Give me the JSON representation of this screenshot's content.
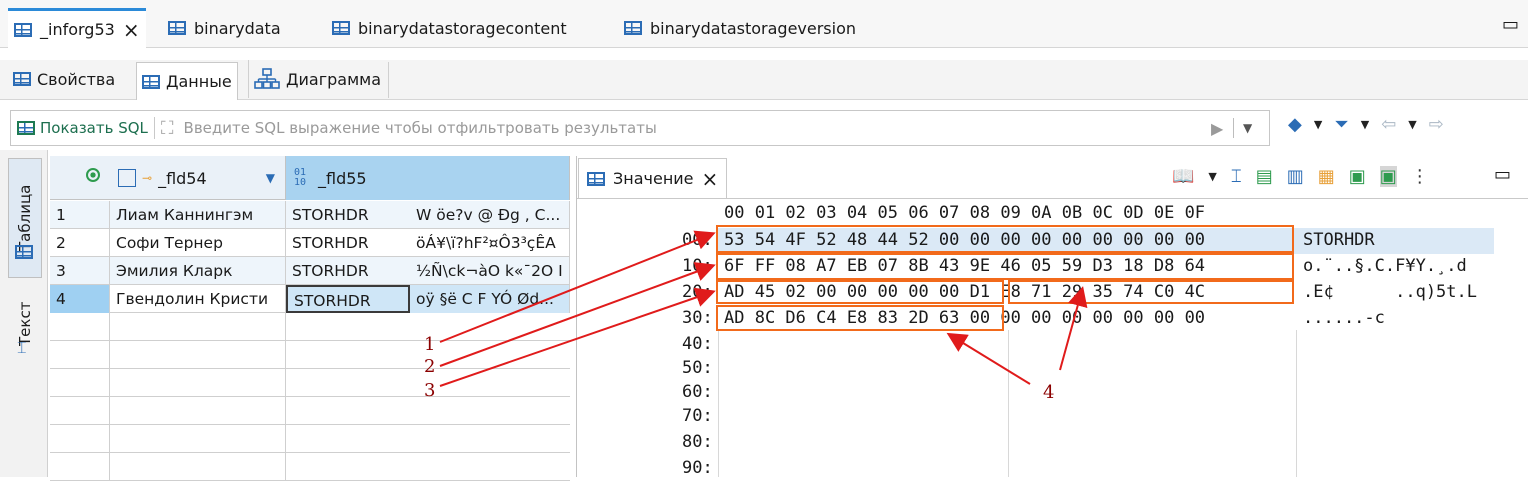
{
  "tabs": [
    {
      "label": "_inforg53",
      "active": true,
      "close": "×"
    },
    {
      "label": "binarydata"
    },
    {
      "label": "binarydatastoragecontent"
    },
    {
      "label": "binarydatastorageversion"
    }
  ],
  "window_minimize": "▭",
  "subtabs": [
    "Свойства",
    "Данные",
    "Диаграмма"
  ],
  "filter": {
    "sql_button": "Показать SQL",
    "placeholder": "Введите SQL выражение чтобы отфильтровать результаты"
  },
  "side_tabs": [
    "Таблица",
    "Текст"
  ],
  "grid": {
    "columns": [
      "_fld54",
      "_fld55"
    ],
    "rows": [
      {
        "num": "1",
        "fld54": "Лиам Каннингэм",
        "fld55": "STORHDR",
        "extra": "W öe?v @ Ðg  , C..."
      },
      {
        "num": "2",
        "fld54": "Софи Тернер",
        "fld55": "STORHDR",
        "extra": "öÁ¥\\ï?hF²¤Ô3³çÊA"
      },
      {
        "num": "3",
        "fld54": "Эмилия Кларк",
        "fld55": "STORHDR",
        "extra": "½Ñ\\ck¬àO k«¯2O I"
      },
      {
        "num": "4",
        "fld54": "Гвендолин Кристи",
        "fld55": "STORHDR",
        "extra": "oÿ §ë  C F YÓ Ød...",
        "selected": true
      }
    ]
  },
  "value_panel": {
    "title": "Значение",
    "close": "×",
    "header": "00 01 02 03 04 05 06 07 08 09 0A 0B 0C 0D 0E 0F",
    "lines": [
      {
        "offset": "00:",
        "hex": "53 54 4F 52 48 44 52 00 00 00 00 00 00 00 00 00",
        "ascii": "STORHDR"
      },
      {
        "offset": "10:",
        "hex": "6F FF 08 A7 EB 07 8B 43 9E 46 05 59 D3 18 D8 64",
        "ascii": "o.¨..§.C.F¥Y.¸.d"
      },
      {
        "offset": "20:",
        "hex": "AD 45 02 00 00 00 00 00 D1 E8 71 29 35 74 C0 4C",
        "ascii": ".E¢      ..q)5t.L"
      },
      {
        "offset": "30:",
        "hex": "AD 8C D6 C4 E8 83 2D 63 00 00 00 00 00 00 00 00",
        "ascii": "......-c"
      },
      {
        "offset": "40:",
        "hex": "",
        "ascii": ""
      },
      {
        "offset": "50:",
        "hex": "",
        "ascii": ""
      },
      {
        "offset": "60:",
        "hex": "",
        "ascii": ""
      },
      {
        "offset": "70:",
        "hex": "",
        "ascii": ""
      },
      {
        "offset": "80:",
        "hex": "",
        "ascii": ""
      },
      {
        "offset": "90:",
        "hex": "",
        "ascii": ""
      }
    ]
  },
  "annotations": [
    "1",
    "2",
    "3",
    "4"
  ],
  "colors": {
    "accent": "#2b8ad8",
    "highlight_box": "#f26a1b",
    "arrow": "#e01b1b",
    "selected_row": "#cfe6f7"
  }
}
